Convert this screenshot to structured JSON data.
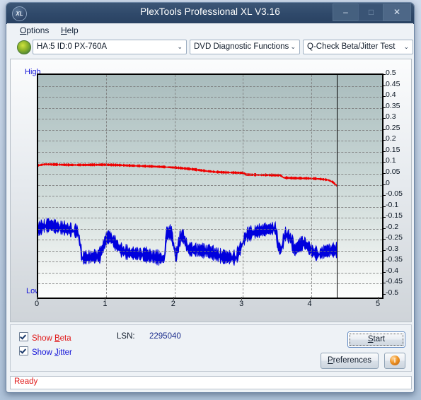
{
  "window": {
    "title": "PlexTools Professional XL V3.16",
    "logo_text": "XL",
    "minimize": "–",
    "maximize": "□",
    "close": "✕"
  },
  "menu": {
    "items": [
      {
        "label": "Options",
        "accel": "O"
      },
      {
        "label": "Help",
        "accel": "H"
      }
    ]
  },
  "toolbar": {
    "drive": "HA:5 ID:0  PX-760A",
    "function": "DVD Diagnostic Functions",
    "test": "Q-Check Beta/Jitter Test",
    "arrow": "⌄"
  },
  "chart_labels": {
    "high": "High",
    "low": "Low"
  },
  "controls": {
    "show_beta": "Show Beta",
    "show_beta_accel": "B",
    "show_beta_checked": true,
    "show_jitter": "Show Jitter",
    "show_jitter_accel": "J",
    "show_jitter_checked": true,
    "lsn_label": "LSN:",
    "lsn_value": "2295040",
    "start": "Start",
    "start_accel": "S",
    "preferences": "Preferences",
    "preferences_accel": "P",
    "info_glyph": "i"
  },
  "status": {
    "text": "Ready",
    "color": "#e01818"
  },
  "colors": {
    "beta_trace": "#ee0000",
    "jitter_trace": "#0000dd",
    "axis_label": "#1414d8",
    "titlebar": "#2f496a"
  },
  "chart_data": {
    "type": "line",
    "title": "Q-Check Beta/Jitter Test",
    "xlabel": "",
    "ylabel": "",
    "xlim": [
      0,
      5
    ],
    "ylim": [
      -0.5,
      0.5
    ],
    "grid": true,
    "legend": "none",
    "x_ticks": [
      0,
      1,
      2,
      3,
      4,
      5
    ],
    "y_ticks": [
      0.5,
      0.45,
      0.4,
      0.35,
      0.3,
      0.25,
      0.2,
      0.15,
      0.1,
      0.05,
      0,
      -0.05,
      -0.1,
      -0.15,
      -0.2,
      -0.25,
      -0.3,
      -0.35,
      -0.4,
      -0.45,
      -0.5
    ],
    "data_end_x": 4.38,
    "cursor_x": 4.38,
    "noise": {
      "beta": 0.006,
      "jitter": 0.035
    },
    "series": [
      {
        "name": "Beta",
        "color": "#ee0000",
        "x": [
          0.0,
          0.1,
          0.25,
          0.45,
          0.7,
          0.95,
          1.2,
          1.45,
          1.7,
          1.9,
          2.05,
          2.25,
          2.45,
          2.6,
          2.75,
          2.9,
          3.0,
          3.05,
          3.2,
          3.4,
          3.55,
          3.6,
          3.75,
          3.95,
          4.1,
          4.25,
          4.32,
          4.38
        ],
        "y": [
          0.088,
          0.093,
          0.092,
          0.09,
          0.09,
          0.091,
          0.089,
          0.086,
          0.083,
          0.08,
          0.077,
          0.071,
          0.063,
          0.058,
          0.056,
          0.055,
          0.054,
          0.046,
          0.045,
          0.044,
          0.043,
          0.032,
          0.03,
          0.029,
          0.027,
          0.022,
          0.012,
          -0.005
        ]
      },
      {
        "name": "Jitter",
        "color": "#0000dd",
        "x": [
          0.0,
          0.08,
          0.18,
          0.28,
          0.38,
          0.5,
          0.58,
          0.62,
          0.64,
          0.78,
          0.9,
          1.0,
          1.05,
          1.12,
          1.22,
          1.3,
          1.42,
          1.55,
          1.7,
          1.85,
          1.88,
          1.95,
          2.02,
          2.08,
          2.12,
          2.2,
          2.35,
          2.5,
          2.7,
          2.9,
          3.05,
          3.2,
          3.35,
          3.48,
          3.52,
          3.56,
          3.62,
          3.7,
          3.76,
          3.82,
          3.9,
          4.0,
          4.1,
          4.2,
          4.3,
          4.38
        ],
        "y": [
          -0.205,
          -0.19,
          -0.185,
          -0.195,
          -0.2,
          -0.21,
          -0.215,
          -0.28,
          -0.335,
          -0.33,
          -0.325,
          -0.245,
          -0.238,
          -0.265,
          -0.3,
          -0.31,
          -0.315,
          -0.32,
          -0.33,
          -0.34,
          -0.225,
          -0.218,
          -0.33,
          -0.245,
          -0.232,
          -0.295,
          -0.3,
          -0.305,
          -0.33,
          -0.335,
          -0.23,
          -0.215,
          -0.205,
          -0.2,
          -0.285,
          -0.3,
          -0.225,
          -0.245,
          -0.3,
          -0.28,
          -0.265,
          -0.3,
          -0.32,
          -0.305,
          -0.3,
          -0.3
        ]
      }
    ]
  }
}
